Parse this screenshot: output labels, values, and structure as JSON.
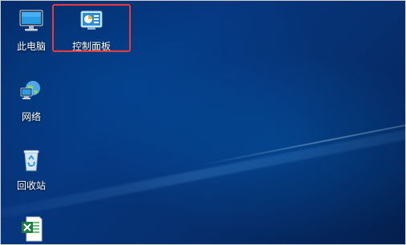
{
  "desktop": {
    "icons": [
      {
        "label": "此电脑",
        "icon": "this-pc-icon"
      },
      {
        "label": "控制面板",
        "icon": "control-panel-icon"
      },
      {
        "label": "网络",
        "icon": "network-icon"
      },
      {
        "label": "回收站",
        "icon": "recycle-bin-icon"
      },
      {
        "label": "",
        "icon": "excel-file-icon"
      }
    ],
    "selected_label": "控制面板"
  },
  "colors": {
    "highlight_border": "#ea3a3a",
    "wallpaper": "#06367e"
  }
}
